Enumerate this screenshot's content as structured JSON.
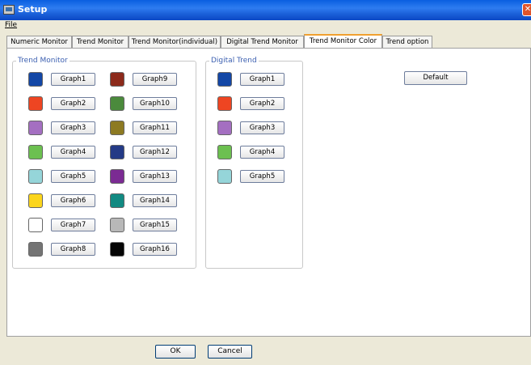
{
  "window": {
    "title": "Setup"
  },
  "menu": {
    "file": "File"
  },
  "tabs": [
    {
      "label": "Numeric Monitor"
    },
    {
      "label": "Trend Monitor"
    },
    {
      "label": "Trend Monitor(individual)"
    },
    {
      "label": "Digital Trend Monitor"
    },
    {
      "label": "Trend Monitor Color"
    },
    {
      "label": "Trend option"
    }
  ],
  "active_tab": "Trend Monitor Color",
  "trend_monitor": {
    "label": "Trend Monitor",
    "items": [
      {
        "label": "Graph1",
        "color": "#1347a6"
      },
      {
        "label": "Graph2",
        "color": "#ee4522"
      },
      {
        "label": "Graph3",
        "color": "#a46fc1"
      },
      {
        "label": "Graph4",
        "color": "#6cc050"
      },
      {
        "label": "Graph5",
        "color": "#95d5d9"
      },
      {
        "label": "Graph6",
        "color": "#fbd51c"
      },
      {
        "label": "Graph7",
        "color": "#ffffff"
      },
      {
        "label": "Graph8",
        "color": "#747474"
      },
      {
        "label": "Graph9",
        "color": "#8c2a1b"
      },
      {
        "label": "Graph10",
        "color": "#4b8a3c"
      },
      {
        "label": "Graph11",
        "color": "#8d7a22"
      },
      {
        "label": "Graph12",
        "color": "#243a86"
      },
      {
        "label": "Graph13",
        "color": "#7b2b93"
      },
      {
        "label": "Graph14",
        "color": "#128a82"
      },
      {
        "label": "Graph15",
        "color": "#b8b8b8"
      },
      {
        "label": "Graph16",
        "color": "#050505"
      }
    ]
  },
  "digital_trend": {
    "label": "Digital Trend",
    "items": [
      {
        "label": "Graph1",
        "color": "#1347a6"
      },
      {
        "label": "Graph2",
        "color": "#ee4522"
      },
      {
        "label": "Graph3",
        "color": "#a46fc1"
      },
      {
        "label": "Graph4",
        "color": "#6cc050"
      },
      {
        "label": "Graph5",
        "color": "#95d5d9"
      }
    ]
  },
  "buttons": {
    "default": "Default",
    "ok": "OK",
    "cancel": "Cancel"
  }
}
